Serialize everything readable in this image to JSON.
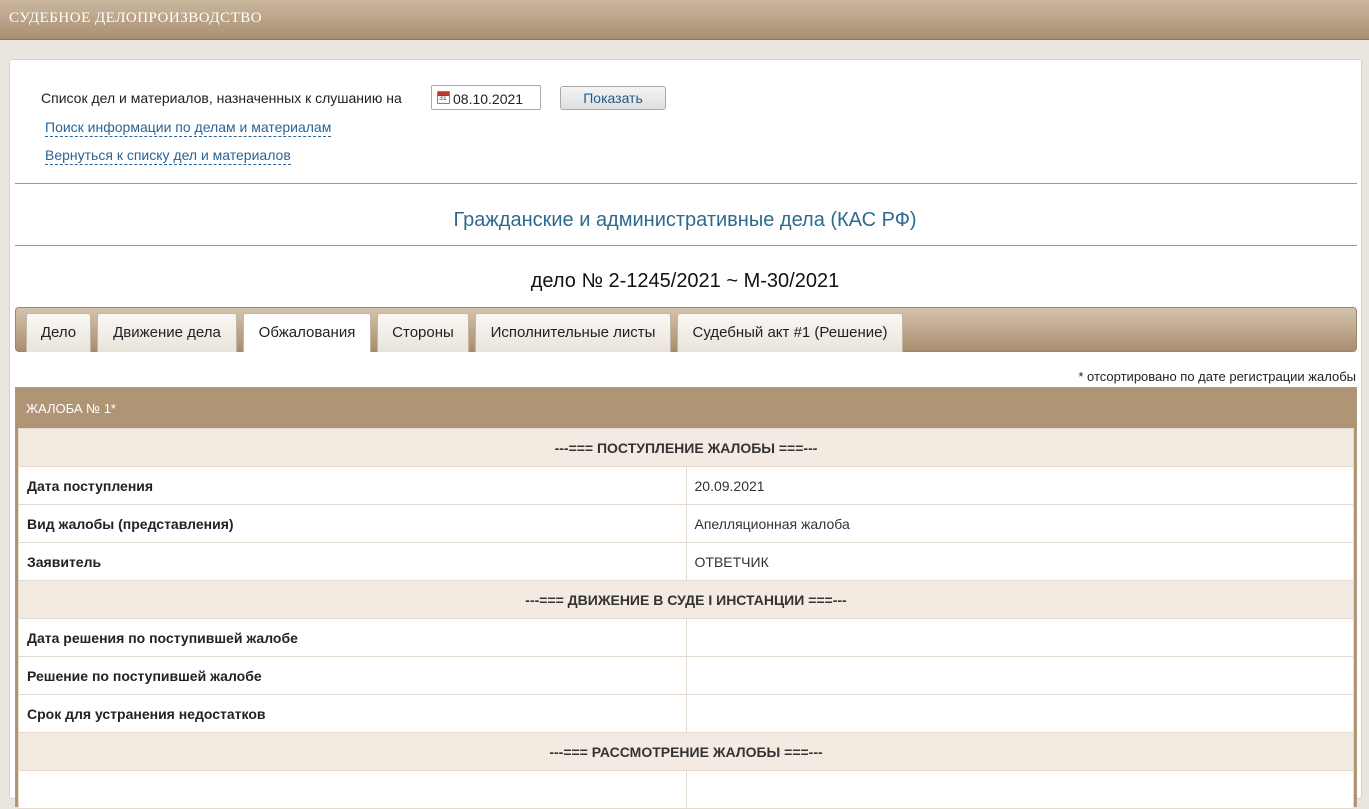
{
  "header": {
    "title": "СУДЕБНОЕ ДЕЛОПРОИЗВОДСТВО"
  },
  "filter": {
    "label": "Список дел и материалов, назначенных к слушанию на",
    "date": "08.10.2021",
    "show_button": "Показать",
    "search_link": "Поиск информации по делам и материалам",
    "back_link": "Вернуться к списку дел и материалов"
  },
  "section_title": "Гражданские и административные дела (КАС РФ)",
  "case_number": "дело № 2-1245/2021 ~ М-30/2021",
  "tabs": [
    {
      "label": "Дело"
    },
    {
      "label": "Движение дела"
    },
    {
      "label": "Обжалования"
    },
    {
      "label": "Стороны"
    },
    {
      "label": "Исполнительные листы"
    },
    {
      "label": "Судебный акт #1 (Решение)"
    }
  ],
  "active_tab": "Обжалования",
  "sort_note": "* отсортировано по дате регистрации жалобы",
  "complaint": {
    "title": "ЖАЛОБА № 1*",
    "sections": [
      {
        "heading": "---=== ПОСТУПЛЕНИЕ ЖАЛОБЫ ===---"
      },
      {
        "heading": "---=== ДВИЖЕНИЕ В СУДЕ I ИНСТАНЦИИ ===---"
      },
      {
        "heading": "---=== РАССМОТРЕНИЕ ЖАЛОБЫ ===---"
      }
    ],
    "rows": [
      {
        "label": "Дата поступления",
        "value": "20.09.2021"
      },
      {
        "label": "Вид жалобы (представления)",
        "value": "Апелляционная жалоба"
      },
      {
        "label": "Заявитель",
        "value": "ОТВЕТЧИК"
      },
      {
        "label": "Дата решения по поступившей жалобе",
        "value": ""
      },
      {
        "label": "Решение по поступившей жалобе",
        "value": ""
      },
      {
        "label": "Срок для устранения недостатков",
        "value": ""
      }
    ]
  },
  "colors": {
    "header_bar": "#a98f72",
    "link": "#2a6496",
    "section_title": "#2d6a8f",
    "complaint_header": "#b09476",
    "section_row": "#f3ebe2"
  }
}
